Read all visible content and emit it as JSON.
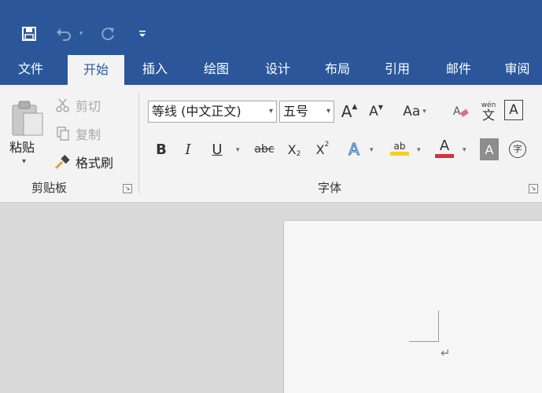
{
  "quick_access": {
    "save_icon": "save-icon",
    "undo_icon": "undo-icon",
    "redo_icon": "redo-icon",
    "customize_icon": "customize-icon"
  },
  "tabs": [
    {
      "label": "文件",
      "active": false
    },
    {
      "label": "开始",
      "active": true
    },
    {
      "label": "插入",
      "active": false
    },
    {
      "label": "绘图",
      "active": false
    },
    {
      "label": "设计",
      "active": false
    },
    {
      "label": "布局",
      "active": false
    },
    {
      "label": "引用",
      "active": false
    },
    {
      "label": "邮件",
      "active": false
    },
    {
      "label": "审阅",
      "active": false
    }
  ],
  "clipboard": {
    "paste_label": "粘贴",
    "cut_label": "剪切",
    "copy_label": "复制",
    "format_painter_label": "格式刷",
    "group_label": "剪贴板"
  },
  "font": {
    "font_name": "等线 (中文正文)",
    "font_size": "五号",
    "grow_font_glyph": "A",
    "shrink_font_glyph": "A",
    "change_case_glyph": "Aa",
    "phonetic_top": "wén",
    "phonetic_bottom": "文",
    "char_border_glyph": "A",
    "bold_glyph": "B",
    "italic_glyph": "I",
    "underline_glyph": "U",
    "strike_glyph": "abc",
    "subscript_glyph": "X",
    "subscript_mark": "2",
    "superscript_glyph": "X",
    "superscript_mark": "2",
    "text_effect_glyph": "A",
    "highlight_glyph": "ab",
    "font_color_glyph": "A",
    "char_shading_glyph": "A",
    "enclose_glyph": "字",
    "group_label": "字体"
  },
  "colors": {
    "accent": "#2b579a",
    "highlight": "#f2d11f",
    "font_color": "#d13438"
  },
  "document": {
    "paragraph_mark": "↵"
  }
}
